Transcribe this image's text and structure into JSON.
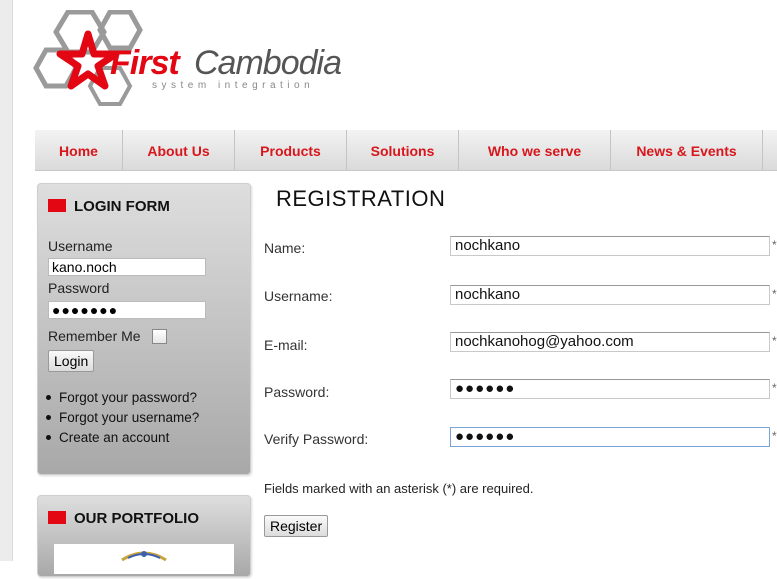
{
  "logo": {
    "brand_first": "First",
    "brand_rest": "Cambodia",
    "tagline": "system integration",
    "colors": {
      "red": "#e30613",
      "gray": "#555555"
    }
  },
  "nav": {
    "items": [
      {
        "label": "Home"
      },
      {
        "label": "About Us"
      },
      {
        "label": "Products"
      },
      {
        "label": "Solutions"
      },
      {
        "label": "Who we serve"
      },
      {
        "label": "News & Events"
      }
    ],
    "color": "#d8161b"
  },
  "login": {
    "title": "LOGIN FORM",
    "username_label": "Username",
    "username_value": "kano.noch",
    "password_label": "Password",
    "password_value": "●●●●●●●",
    "remember_label": "Remember Me",
    "remember_checked": false,
    "submit_label": "Login",
    "links": [
      {
        "label": "Forgot your password?"
      },
      {
        "label": "Forgot your username?"
      },
      {
        "label": "Create an account"
      }
    ]
  },
  "portfolio": {
    "title": "OUR PORTFOLIO"
  },
  "registration": {
    "title": "REGISTRATION",
    "fields": [
      {
        "label": "Name:",
        "value": "nochkano",
        "asterisk": "*"
      },
      {
        "label": "Username:",
        "value": "nochkano",
        "asterisk": "*"
      },
      {
        "label": "E-mail:",
        "value": "nochkanohog@yahoo.com",
        "asterisk": "*"
      },
      {
        "label": "Password:",
        "value": "●●●●●●",
        "asterisk": "*"
      },
      {
        "label": "Verify Password:",
        "value": "●●●●●●",
        "asterisk": "*"
      }
    ],
    "note": "Fields marked with an asterisk (*) are required.",
    "submit_label": "Register"
  }
}
